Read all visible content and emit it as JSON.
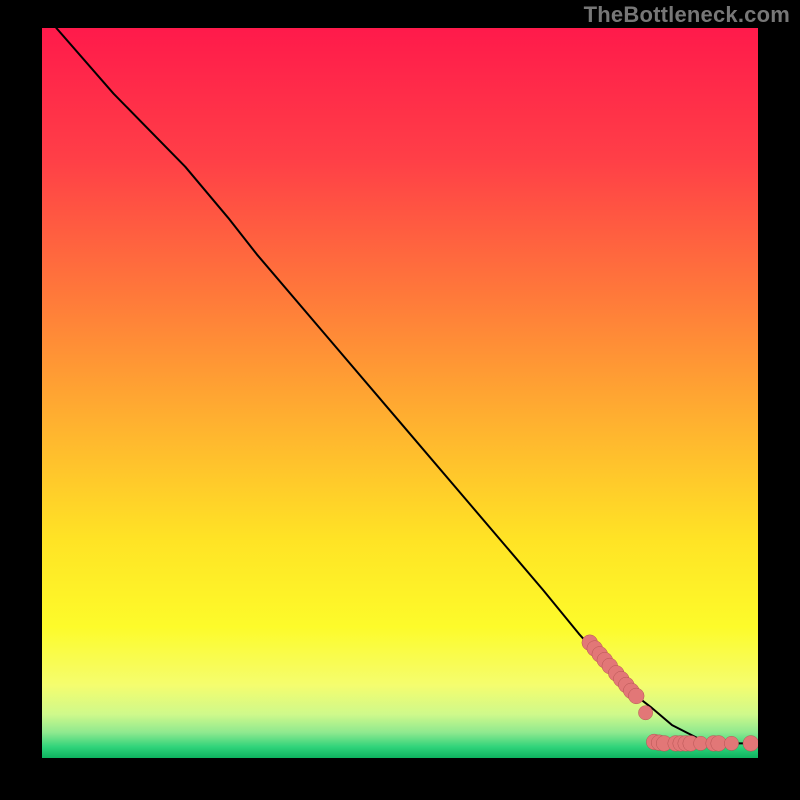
{
  "watermark": "TheBottleneck.com",
  "colors": {
    "frame": "#000000",
    "watermark": "#777777",
    "line": "#000000",
    "marker_fill": "#e27777",
    "marker_stroke": "#a94a4a",
    "gradient_stops": [
      {
        "offset": 0.0,
        "color": "#ff1a4b"
      },
      {
        "offset": 0.18,
        "color": "#ff3f47"
      },
      {
        "offset": 0.37,
        "color": "#ff7a3a"
      },
      {
        "offset": 0.55,
        "color": "#ffb42f"
      },
      {
        "offset": 0.7,
        "color": "#ffe325"
      },
      {
        "offset": 0.82,
        "color": "#fdfb2a"
      },
      {
        "offset": 0.9,
        "color": "#f5fd6e"
      },
      {
        "offset": 0.94,
        "color": "#cff98b"
      },
      {
        "offset": 0.965,
        "color": "#8fe98f"
      },
      {
        "offset": 0.985,
        "color": "#2fd37a"
      },
      {
        "offset": 1.0,
        "color": "#0db25f"
      }
    ]
  },
  "chart_data": {
    "type": "line",
    "title": "",
    "xlabel": "",
    "ylabel": "",
    "xlim": [
      0,
      100
    ],
    "ylim": [
      0,
      100
    ],
    "grid": false,
    "legend": false,
    "series": [
      {
        "name": "curve",
        "x": [
          2,
          10,
          20,
          26,
          30,
          40,
          50,
          60,
          70,
          75,
          80,
          83,
          85,
          88,
          92,
          95,
          100
        ],
        "y": [
          100,
          91,
          81,
          74,
          69,
          57.5,
          46,
          34.5,
          23,
          17,
          11.5,
          8.5,
          7,
          4.5,
          2.5,
          2,
          2
        ]
      }
    ],
    "markers": [
      {
        "x": 76.5,
        "y": 15.8,
        "r": 1.1
      },
      {
        "x": 77.2,
        "y": 15.0,
        "r": 1.1
      },
      {
        "x": 77.9,
        "y": 14.2,
        "r": 1.1
      },
      {
        "x": 78.6,
        "y": 13.4,
        "r": 1.1
      },
      {
        "x": 79.3,
        "y": 12.6,
        "r": 1.1
      },
      {
        "x": 80.2,
        "y": 11.6,
        "r": 1.1
      },
      {
        "x": 80.9,
        "y": 10.8,
        "r": 1.1
      },
      {
        "x": 81.6,
        "y": 10.0,
        "r": 1.1
      },
      {
        "x": 82.3,
        "y": 9.2,
        "r": 1.1
      },
      {
        "x": 83.0,
        "y": 8.5,
        "r": 1.1
      },
      {
        "x": 84.3,
        "y": 6.2,
        "r": 1.0
      },
      {
        "x": 85.5,
        "y": 2.2,
        "r": 1.1
      },
      {
        "x": 86.2,
        "y": 2.1,
        "r": 1.1
      },
      {
        "x": 86.9,
        "y": 2.0,
        "r": 1.1
      },
      {
        "x": 88.5,
        "y": 2.0,
        "r": 1.1
      },
      {
        "x": 89.2,
        "y": 2.0,
        "r": 1.1
      },
      {
        "x": 89.9,
        "y": 2.0,
        "r": 1.1
      },
      {
        "x": 90.6,
        "y": 2.0,
        "r": 1.1
      },
      {
        "x": 92.0,
        "y": 2.0,
        "r": 1.0
      },
      {
        "x": 93.8,
        "y": 2.0,
        "r": 1.1
      },
      {
        "x": 94.5,
        "y": 2.0,
        "r": 1.1
      },
      {
        "x": 96.3,
        "y": 2.0,
        "r": 1.0
      },
      {
        "x": 99.0,
        "y": 2.0,
        "r": 1.1
      }
    ]
  }
}
